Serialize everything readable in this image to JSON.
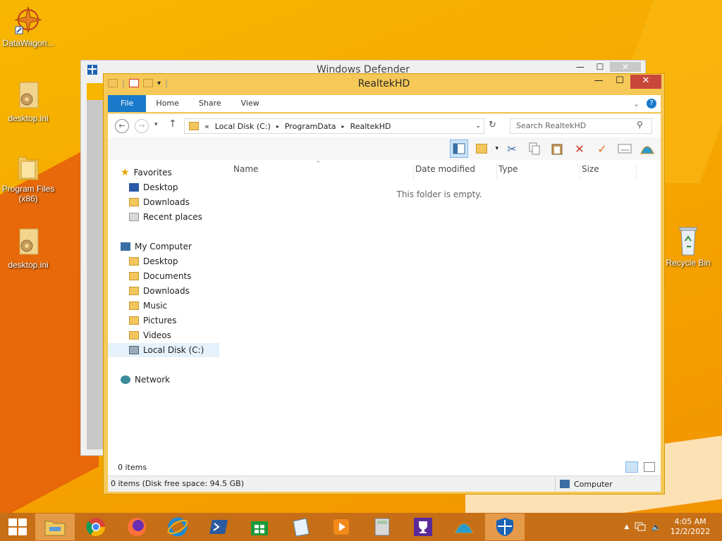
{
  "desktop": {
    "icons": [
      {
        "label": "DataWagon..."
      },
      {
        "label": "desktop.ini"
      },
      {
        "label": "Program Files (x86)"
      },
      {
        "label": "desktop.ini"
      },
      {
        "label": "Recycle Bin"
      }
    ]
  },
  "defender": {
    "title": "Windows Defender"
  },
  "explorer": {
    "title": "RealtekHD",
    "tabs": {
      "file": "File",
      "home": "Home",
      "share": "Share",
      "view": "View"
    },
    "address": {
      "overflow": "«",
      "crumbs": [
        "Local Disk (C:)",
        "ProgramData",
        "RealtekHD"
      ]
    },
    "search": {
      "placeholder": "Search RealtekHD"
    },
    "nav": {
      "favorites": "Favorites",
      "fav_items": [
        "Desktop",
        "Downloads",
        "Recent places"
      ],
      "computer": "My Computer",
      "comp_items": [
        "Desktop",
        "Documents",
        "Downloads",
        "Music",
        "Pictures",
        "Videos",
        "Local Disk (C:)"
      ],
      "network": "Network"
    },
    "columns": {
      "name": "Name",
      "date": "Date modified",
      "type": "Type",
      "size": "Size"
    },
    "empty_text": "This folder is empty.",
    "item_count": "0 items",
    "status": {
      "left": "0 items (Disk free space: 94.5 GB)",
      "right": "Computer"
    }
  },
  "taskbar": {
    "time": "4:05 AM",
    "date": "12/2/2022"
  },
  "colors": {
    "accent": "#1979ca",
    "taskbar": "#c66f16",
    "window_frame": "#f5c857"
  }
}
